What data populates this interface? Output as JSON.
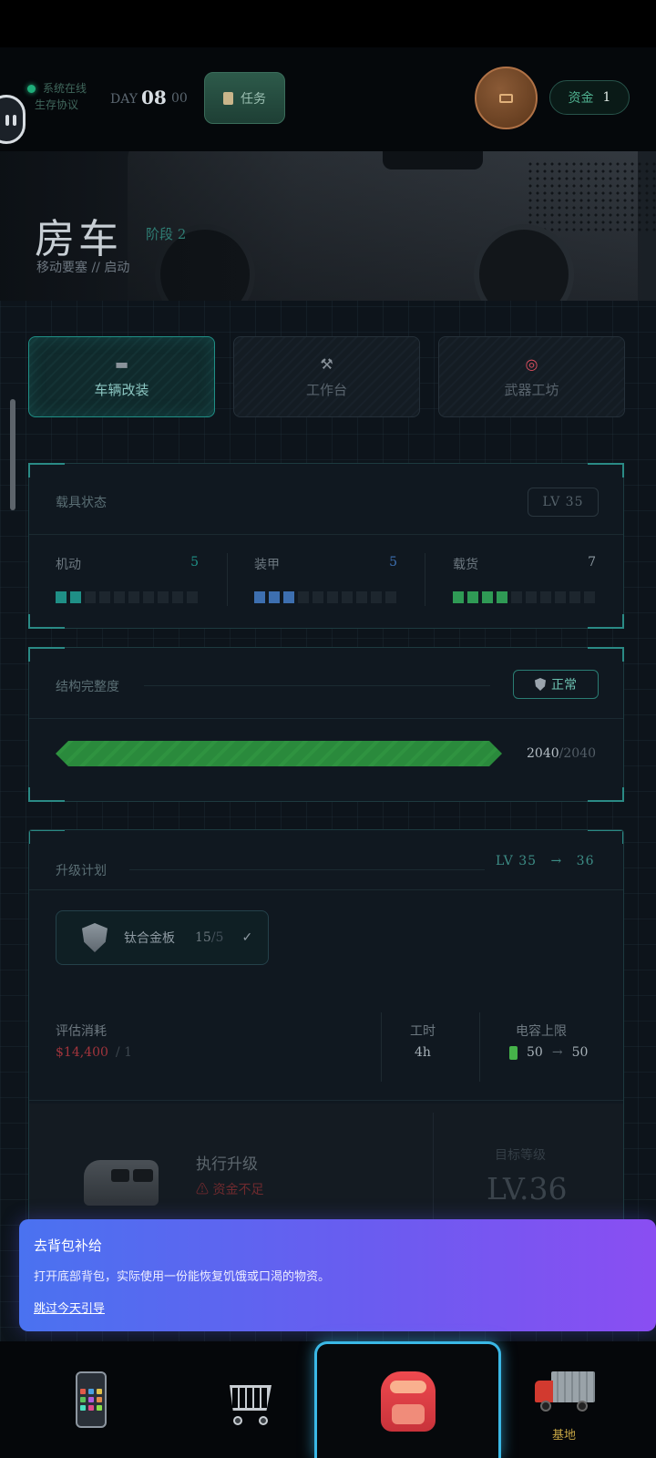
{
  "header": {
    "status_online": "系统在线",
    "status_protocol": "生存协议",
    "day_label": "DAY",
    "day_number": "08",
    "day_sub": "00",
    "task_button": "任务",
    "funds_label": "资金",
    "funds_value": "1",
    "colors": {
      "online": "#1fae7a",
      "accent": "#2a8a85"
    }
  },
  "hero": {
    "title": "房车",
    "stage": "阶段 2",
    "subtitle": "移动要塞 // 启动"
  },
  "tabs": [
    {
      "label": "车辆改装",
      "icon": "van-icon",
      "active": true
    },
    {
      "label": "工作台",
      "icon": "tools-icon",
      "active": false
    },
    {
      "label": "武器工坊",
      "icon": "target-icon",
      "active": false
    }
  ],
  "vehicle_status": {
    "title": "载具状态",
    "level": "LV 35",
    "stats": [
      {
        "label": "机动",
        "value": "5",
        "filled": 2,
        "total": 10,
        "color": "#1f8f86"
      },
      {
        "label": "装甲",
        "value": "5",
        "filled": 3,
        "total": 10,
        "color": "#3d6fb0"
      },
      {
        "label": "载货",
        "value": "7",
        "filled": 4,
        "total": 10,
        "color": "#2f9a55"
      }
    ]
  },
  "integrity": {
    "title": "结构完整度",
    "status": "正常",
    "current": "2040",
    "max": "/2040",
    "fill_fraction": 1.0
  },
  "upgrade": {
    "title": "升级计划",
    "level_from": "LV 35",
    "arrow": "→",
    "level_to": "36",
    "material": {
      "name": "钛合金板",
      "have": "15",
      "need": "/5",
      "check": "✓"
    },
    "cost_label": "评估消耗",
    "cost_value": "$14,400",
    "cost_mult": "/ 1",
    "time_label": "工时",
    "time_value": "4h",
    "cap_label": "电容上限",
    "cap_from": "50",
    "cap_arrow": "→",
    "cap_to": "50",
    "exec_title": "执行升级",
    "exec_warning": "⚠ 资金不足",
    "target_label": "目标等级",
    "target_value": "LV.36"
  },
  "guide": {
    "title": "去背包补给",
    "body": "打开底部背包，实际使用一份能恢复饥饿或口渴的物资。",
    "skip": "跳过今天引导"
  },
  "bottom_nav": [
    {
      "icon": "phone-icon",
      "label": ""
    },
    {
      "icon": "cart-icon",
      "label": ""
    },
    {
      "icon": "backpack-icon",
      "label": "",
      "active": true
    },
    {
      "icon": "truck-icon",
      "label": "基地"
    }
  ]
}
